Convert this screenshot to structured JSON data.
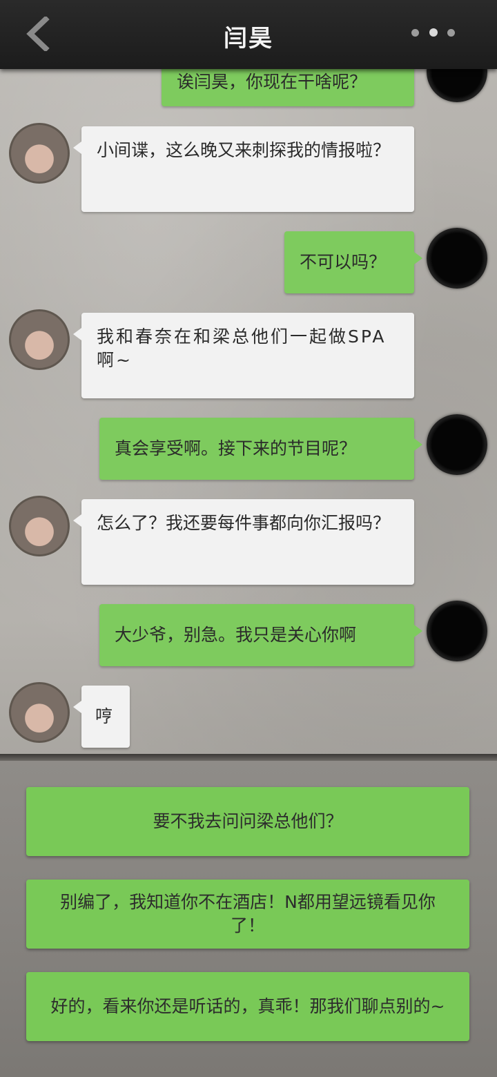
{
  "header": {
    "title": "闫昊",
    "back_icon": "chevron-left-icon",
    "more_icon": "more-dots-icon"
  },
  "messages": [
    {
      "side": "me",
      "text": "诶闫昊，你现在干啥呢？"
    },
    {
      "side": "npc",
      "text": "小间谍，这么晚又来刺探我的情报啦？"
    },
    {
      "side": "me",
      "text": "不可以吗？"
    },
    {
      "side": "npc",
      "text": "我和春奈在和梁总他们一起做SPA啊~"
    },
    {
      "side": "me",
      "text": "真会享受啊。接下来的节目呢？"
    },
    {
      "side": "npc",
      "text": "怎么了？我还要每件事都向你汇报吗？"
    },
    {
      "side": "me",
      "text": "大少爷，别急。我只是关心你啊"
    },
    {
      "side": "npc",
      "text": "哼"
    }
  ],
  "choices": [
    {
      "text": "要不我去问问梁总他们？"
    },
    {
      "text": "别编了，我知道你不在酒店！N都用望远镜看见你了！"
    },
    {
      "text": "好的，看来你还是听话的，真乖！那我们聊点别的~"
    }
  ],
  "colors": {
    "npc_bubble": "#f2f2f2",
    "player_bubble": "#7ecb5e",
    "choice_button": "#79c957",
    "header_bg": "#1f1f1f"
  }
}
